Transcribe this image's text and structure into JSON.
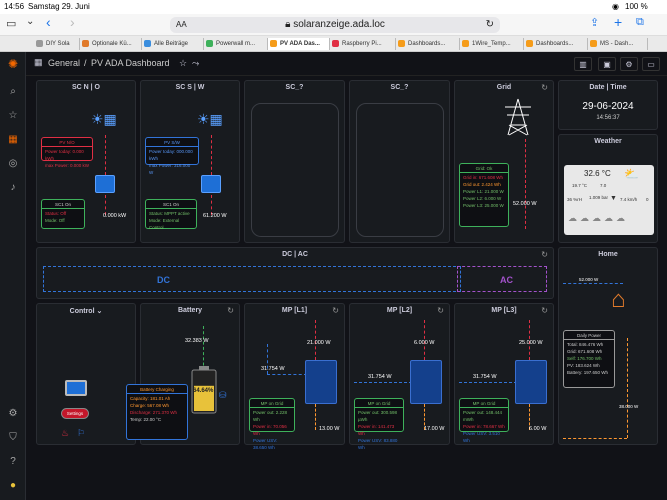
{
  "status": {
    "time": "14:56",
    "date": "Samstag 29. Juni",
    "battery": "100 %"
  },
  "browser": {
    "aa": "AA",
    "url": "solaranzeige.ada.loc"
  },
  "tabs": [
    {
      "label": "DIY Sola",
      "color": "#999"
    },
    {
      "label": "Optionale Kü...",
      "color": "#e07a2b"
    },
    {
      "label": "Alle Beiträge",
      "color": "#3a8dde"
    },
    {
      "label": "Powerwall m...",
      "color": "#3eb15b"
    },
    {
      "label": "PV ADA Das...",
      "color": "#f59c1a"
    },
    {
      "label": "Raspberry Pi...",
      "color": "#e02f44"
    },
    {
      "label": "Dashboards...",
      "color": "#f59c1a"
    },
    {
      "label": "1Wire_Temp...",
      "color": "#f59c1a"
    },
    {
      "label": "Dashboards...",
      "color": "#f59c1a"
    },
    {
      "label": "MS - Dash...",
      "color": "#f59c1a"
    }
  ],
  "breadcrumb": {
    "root": "General",
    "sep": "/",
    "page": "PV ADA Dashboard"
  },
  "panels": {
    "scno": {
      "title": "SC N | O",
      "box1_head": "PV N/O",
      "box1_l1": "Power today: 0.000 kWh",
      "box1_l2": "max Power: 0.000 kW",
      "box2_head": "SC1 On",
      "box2_l1": "Status: Off",
      "box2_l2": "Mode: Off",
      "power": "0.000 kW"
    },
    "scsw": {
      "title": "SC S | W",
      "box1_head": "PV S/W",
      "box1_l1": "Power today: 000.000 kWh",
      "box1_l2": "max Power: 316.000 W",
      "box2_head": "SC1 On",
      "box2_l1": "Status: MPPT active",
      "box2_l2": "Mode: External Control",
      "power": "61.200 W"
    },
    "sc3": {
      "title": "SC_?"
    },
    "sc4": {
      "title": "SC_?"
    },
    "grid": {
      "title": "Grid",
      "box_head": "Grid: Ok",
      "l1": "Grid in: 671.608 Wh",
      "l2": "Grid out: 2.424 Wh",
      "l3": "Power L1: 21.000 W",
      "l4": "Power L2: 6.000 W",
      "l5": "Power L3: 25.000 W",
      "power": "52.000 W"
    },
    "datetime": {
      "title": "Date | Time",
      "date": "29-06-2024",
      "time": "14:56:37"
    },
    "weather": {
      "title": "Weather",
      "temp": "32.6 °C",
      "t1": "19.7 °C",
      "t2": "7.0",
      "h": "36 %rH",
      "p": "1.009 bar",
      "w": "7.4 km/h",
      "n": "0"
    },
    "dcac": {
      "title": "DC | AC",
      "dc": "DC",
      "ac": "AC"
    },
    "home": {
      "title": "Home",
      "power_in": "52.000 W",
      "box_head": "Daily Power",
      "l1": "Total: 846.476 Wh",
      "l2": "Grid: 671.608 Wh",
      "l3": "Self: 176.700 Wh",
      "l4": "PV: 183.624 Wh",
      "l5": "Battery: 197.650 Wh",
      "power_out": "38.000 W"
    },
    "control": {
      "title": "Control",
      "chev": "⌄",
      "btn2": "Settings"
    },
    "battery": {
      "title": "Battery",
      "power": "32.383 W",
      "soc": "64.64%",
      "box_head": "Battery Charging",
      "l1": "Capacity: 181.01 Ah",
      "l2": "Charge: 567.08 Wh",
      "l3": "Discharge: 271.370 Wh",
      "l4": "Temp: 22.00 °C"
    },
    "mp1": {
      "title": "MP [L1]",
      "in": "21.000 W",
      "dc": "31.754 W",
      "box_head": "MP on Grid",
      "l1": "Power out: 2.228 Wh",
      "l2": "Power in: 70.056 Wh",
      "l3": "Power USV: 38.650 Wh",
      "out": "13.00 W"
    },
    "mp2": {
      "title": "MP [L2]",
      "in": "6.000 W",
      "dc": "31.754 W",
      "box_head": "MP on Grid",
      "l1": "Power out: 300.598 µWh",
      "l2": "Power in: 141.473 Wh",
      "l3": "Power USV: 83.880 Wh",
      "out": "17.00 W"
    },
    "mp3": {
      "title": "MP [L3]",
      "in": "25.000 W",
      "dc": "31.754 W",
      "box_head": "MP on Grid",
      "l1": "Power out: 148.444 mWh",
      "l2": "Power in: 78.667 Wh",
      "l3": "Power USV: 3.510 Wh",
      "out": "6.00 W"
    }
  }
}
